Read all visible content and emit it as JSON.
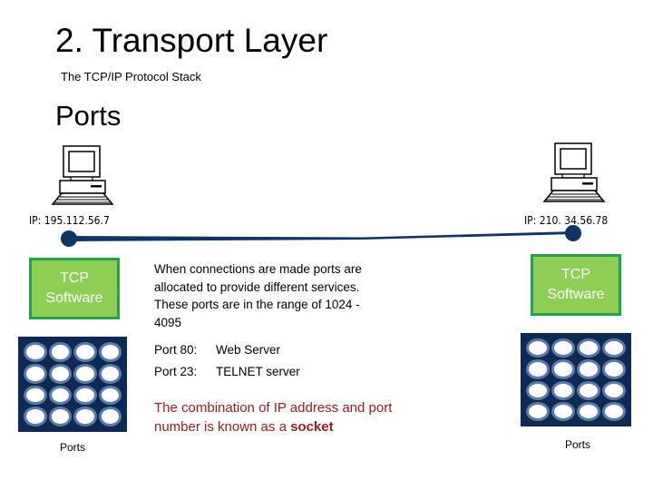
{
  "slide": {
    "title": "2. Transport Layer",
    "subtitle": "The TCP/IP Protocol Stack",
    "section": "Ports"
  },
  "hosts": {
    "left": {
      "icon": "desktop-computer-icon",
      "ip_label": "IP:  195.112.56.7",
      "tcp_box": {
        "line1": "TCP",
        "line2": "Software"
      },
      "ports_label": "Ports"
    },
    "right": {
      "icon": "desktop-computer-icon",
      "ip_label": "IP:  210. 34.56.78",
      "tcp_box": {
        "line1": "TCP",
        "line2": "Software"
      },
      "ports_label": "Ports"
    }
  },
  "description": "When connections are made ports are allocated to provide different services.  These ports are in the range of 1024 - 4095",
  "port_examples": [
    {
      "port": "Port 80:",
      "service": "Web Server"
    },
    {
      "port": "Port 23:",
      "service": "TELNET server"
    }
  ],
  "socket_note": {
    "text": "The combination of IP address and port number is known as a ",
    "emphasis": "socket"
  },
  "colors": {
    "connection_line": "#0d3566",
    "tcp_box_fill": "#8fce55",
    "tcp_box_border": "#22a24a",
    "port_panel": "#0d2a55",
    "port_ring": "#5a7aa8",
    "socket_note_text": "#9b1b1b"
  },
  "port_grid": {
    "rows": 4,
    "cols": 4
  }
}
